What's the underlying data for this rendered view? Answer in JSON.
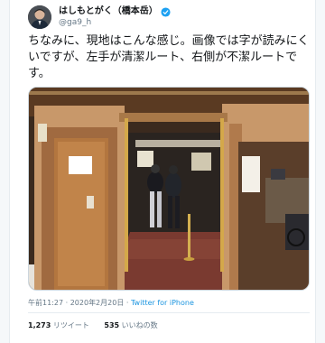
{
  "user": {
    "display_name": "はしもとがく（橋本岳）",
    "handle": "@ga9_h",
    "verified_icon": "verified-badge-icon",
    "accent": "#1da1f2"
  },
  "tweet": {
    "text": "ちなみに、現地はこんな感じ。画像では字が読みにくいですが、左手が清潔ルート、右側が不潔ルートです。"
  },
  "photo": {
    "description_icon": "ship-corridor-photo"
  },
  "meta": {
    "time": "午前11:27",
    "sep": " · ",
    "date": "2020年2月20日",
    "source": "Twitter for iPhone"
  },
  "stats": {
    "retweets_count": "1,273",
    "retweets_label": "リツイート",
    "likes_count": "535",
    "likes_label": "いいねの数"
  }
}
